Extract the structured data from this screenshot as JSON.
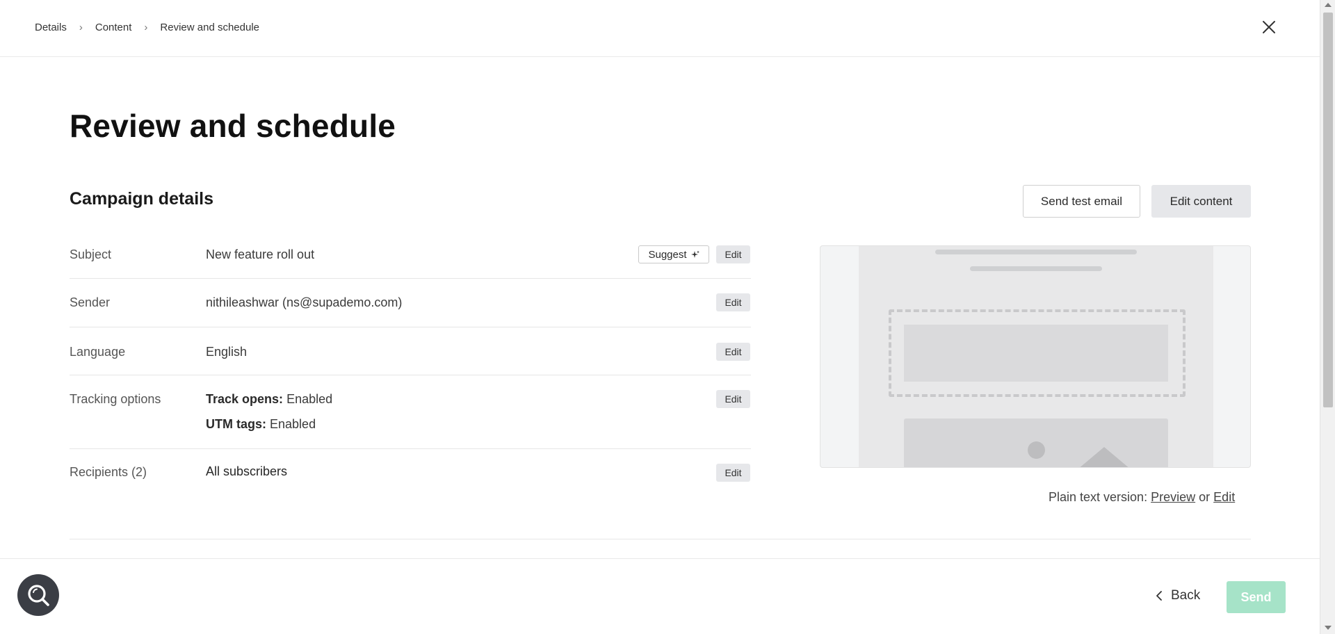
{
  "breadcrumb": {
    "items": [
      "Details",
      "Content",
      "Review and schedule"
    ]
  },
  "page": {
    "title": "Review and schedule",
    "section_title": "Campaign details"
  },
  "actions": {
    "send_test_email": "Send test email",
    "edit_content": "Edit content"
  },
  "details": {
    "edit_label": "Edit",
    "suggest_label": "Suggest",
    "subject": {
      "label": "Subject",
      "value": "New feature roll out"
    },
    "sender": {
      "label": "Sender",
      "value": "nithileashwar (ns@supademo.com)"
    },
    "language": {
      "label": "Language",
      "value": "English"
    },
    "tracking": {
      "label": "Tracking options",
      "opens_key": "Track opens:",
      "opens_value": "Enabled",
      "utm_key": "UTM tags:",
      "utm_value": "Enabled"
    },
    "recipients": {
      "label": "Recipients (2)",
      "value": "All subscribers"
    }
  },
  "plaintext": {
    "prefix": "Plain text version:",
    "preview_link": "Preview",
    "or": "or",
    "edit_link": "Edit"
  },
  "footer": {
    "back_label": "Back",
    "send_label": "Send"
  },
  "colors": {
    "send_button_disabled": "#a6e3c8",
    "help_button": "#3b3e45",
    "edit_chip": "#e6e7ea"
  }
}
